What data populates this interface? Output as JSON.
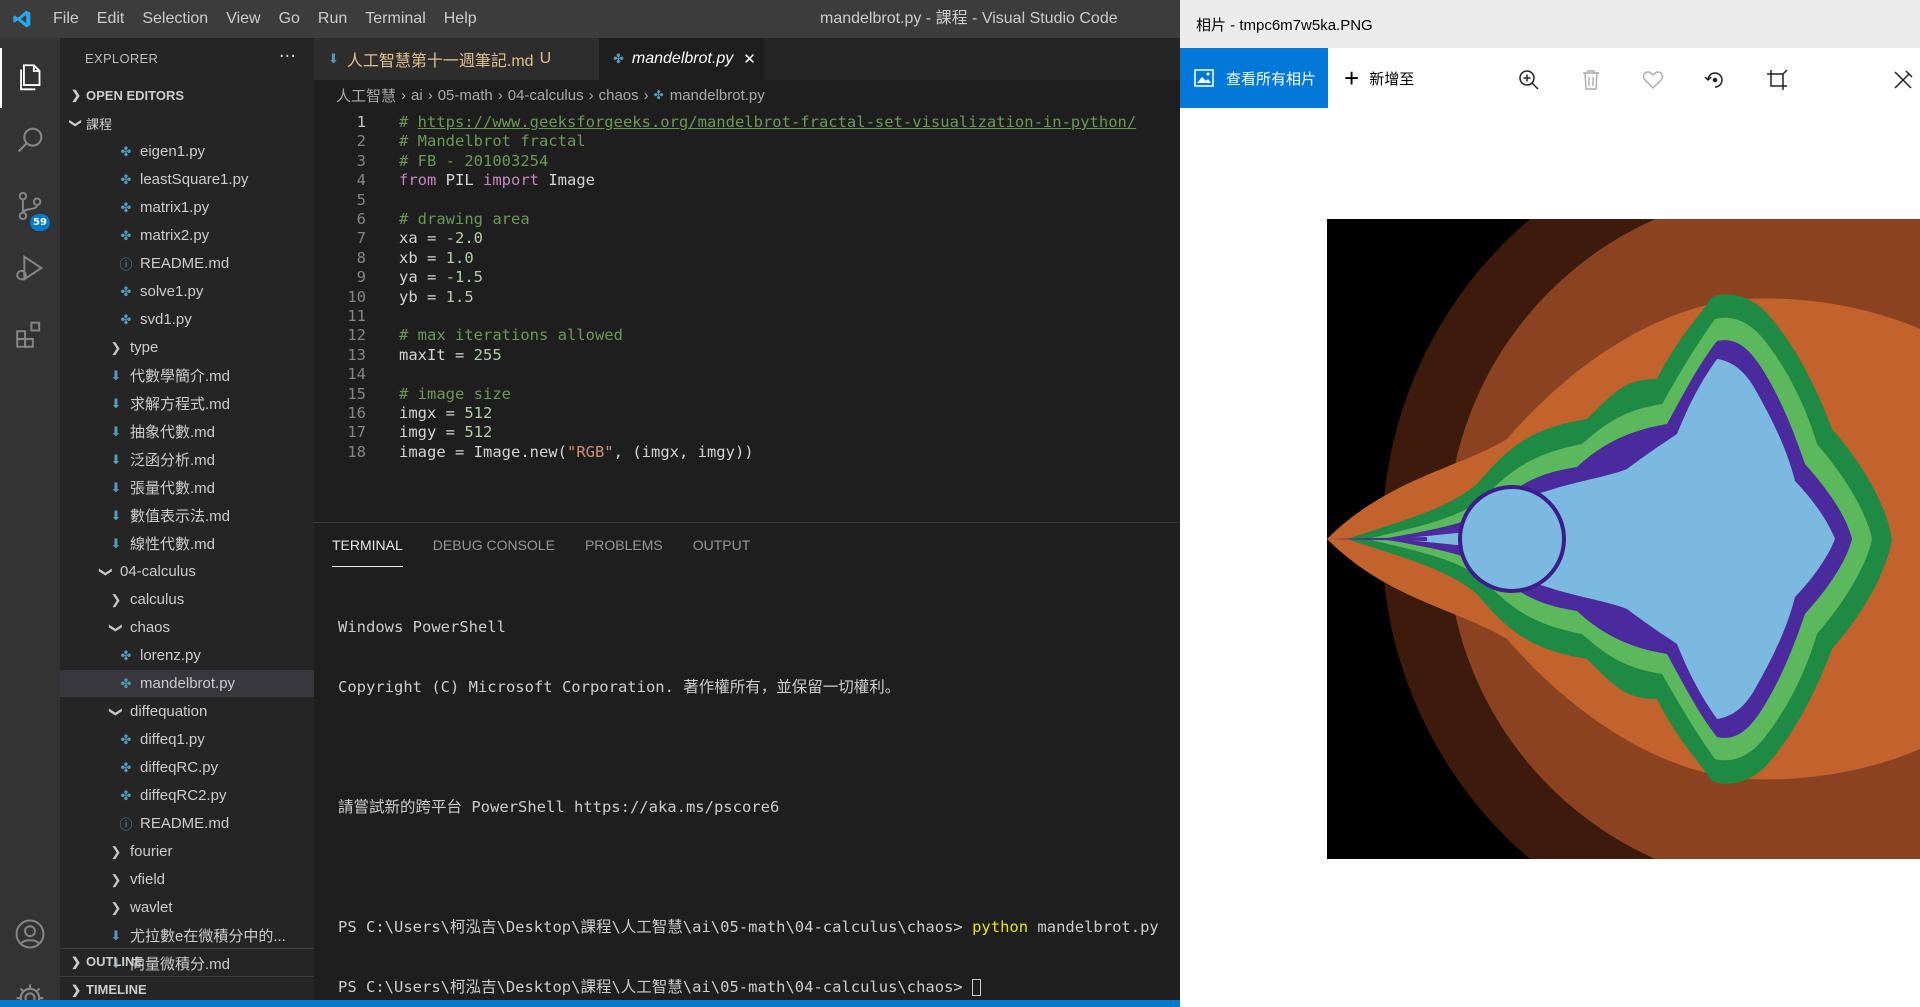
{
  "vscode": {
    "menu": [
      "File",
      "Edit",
      "Selection",
      "View",
      "Go",
      "Run",
      "Terminal",
      "Help"
    ],
    "window_title": "mandelbrot.py - 課程 - Visual Studio Code",
    "scm_badge": "59",
    "explorer": {
      "title": "EXPLORER",
      "more": "···",
      "open_editors": "OPEN EDITORS",
      "folder": "課程",
      "outline": "OUTLINE",
      "timeline": "TIMELINE",
      "tree": [
        {
          "label": "eigen1.py",
          "icon": "python-icon"
        },
        {
          "label": "leastSquare1.py",
          "icon": "python-icon"
        },
        {
          "label": "matrix1.py",
          "icon": "python-icon"
        },
        {
          "label": "matrix2.py",
          "icon": "python-icon"
        },
        {
          "label": "README.md",
          "icon": "info-icon"
        },
        {
          "label": "solve1.py",
          "icon": "python-icon"
        },
        {
          "label": "svd1.py",
          "icon": "python-icon"
        },
        {
          "label": "type",
          "icon": "chevron-right-icon"
        },
        {
          "label": "代數學簡介.md",
          "icon": "markdown-icon"
        },
        {
          "label": "求解方程式.md",
          "icon": "markdown-icon"
        },
        {
          "label": "抽象代數.md",
          "icon": "markdown-icon"
        },
        {
          "label": "泛函分析.md",
          "icon": "markdown-icon"
        },
        {
          "label": "張量代數.md",
          "icon": "markdown-icon"
        },
        {
          "label": "數值表示法.md",
          "icon": "markdown-icon"
        },
        {
          "label": "線性代數.md",
          "icon": "markdown-icon"
        },
        {
          "label": "04-calculus",
          "icon": "chevron-down-icon"
        },
        {
          "label": "calculus",
          "icon": "chevron-right-icon"
        },
        {
          "label": "chaos",
          "icon": "chevron-down-icon"
        },
        {
          "label": "lorenz.py",
          "icon": "python-icon"
        },
        {
          "label": "mandelbrot.py",
          "icon": "python-icon"
        },
        {
          "label": "diffequation",
          "icon": "chevron-down-icon"
        },
        {
          "label": "diffeq1.py",
          "icon": "python-icon"
        },
        {
          "label": "diffeqRC.py",
          "icon": "python-icon"
        },
        {
          "label": "diffeqRC2.py",
          "icon": "python-icon"
        },
        {
          "label": "README.md",
          "icon": "info-icon"
        },
        {
          "label": "fourier",
          "icon": "chevron-right-icon"
        },
        {
          "label": "vfield",
          "icon": "chevron-right-icon"
        },
        {
          "label": "wavlet",
          "icon": "chevron-right-icon"
        },
        {
          "label": "尤拉數e在微積分中的...",
          "icon": "markdown-icon"
        },
        {
          "label": "向量微積分.md",
          "icon": "markdown-icon"
        }
      ]
    },
    "tabs": [
      {
        "label": "人工智慧第十一週筆記.md",
        "status": "U"
      },
      {
        "label": "mandelbrot.py",
        "close": "✕"
      }
    ],
    "breadcrumb": [
      "人工智慧",
      "ai",
      "05-math",
      "04-calculus",
      "chaos",
      "mandelbrot.py"
    ],
    "code_lines": [
      "# https://www.geeksforgeeks.org/mandelbrot-fractal-set-visualization-in-python/",
      "# Mandelbrot fractal",
      "# FB - 201003254",
      "from PIL import Image",
      "",
      "# drawing area",
      "xa = -2.0",
      "xb = 1.0",
      "ya = -1.5",
      "yb = 1.5",
      "",
      "# max iterations allowed",
      "maxIt = 255",
      "",
      "# image size",
      "imgx = 512",
      "imgy = 512",
      "image = Image.new(\"RGB\", (imgx, imgy))"
    ],
    "panel_tabs": [
      "TERMINAL",
      "DEBUG CONSOLE",
      "PROBLEMS",
      "OUTPUT"
    ],
    "terminal": {
      "line1": "Windows PowerShell",
      "line2": "Copyright (C) Microsoft Corporation. 著作權所有，並保留一切權利。",
      "line3": "請嘗試新的跨平台 PowerShell https://aka.ms/pscore6",
      "prompt": "PS C:\\Users\\柯泓吉\\Desktop\\課程\\人工智慧\\ai\\05-math\\04-calculus\\chaos> ",
      "cmd_name": "python",
      "cmd_arg": " mandelbrot.py"
    }
  },
  "photos": {
    "title": "相片 - tmpc6m7w5ka.PNG",
    "view_all": "查看所有相片",
    "add_to": "新增至",
    "tools": [
      "zoom-in-icon",
      "delete-icon",
      "favorite-icon",
      "rotate-icon",
      "crop-icon",
      "edit-icon"
    ],
    "colors": {
      "accent": "#0078d7"
    }
  },
  "colors": {
    "vscode_bg": "#1e1e1e",
    "sidebar_bg": "#252526",
    "activitybar_bg": "#333333",
    "accent": "#007acc"
  }
}
